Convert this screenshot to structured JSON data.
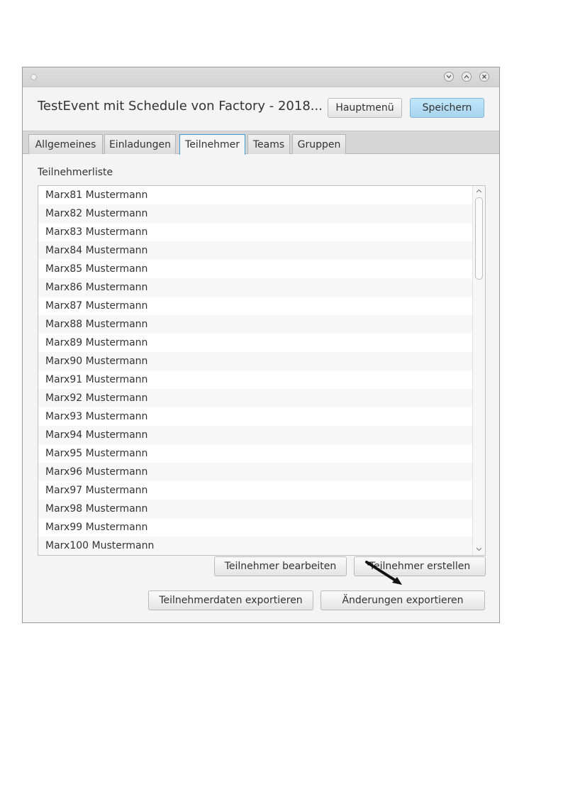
{
  "window": {
    "title": "TestEvent mit Schedule von Factory - 2018...",
    "hauptmenu_label": "Hauptmenü",
    "save_label": "Speichern"
  },
  "tabs": [
    {
      "label": "Allgemeines",
      "active": false
    },
    {
      "label": "Einladungen",
      "active": false
    },
    {
      "label": "Teilnehmer",
      "active": true
    },
    {
      "label": "Teams",
      "active": false
    },
    {
      "label": "Gruppen",
      "active": false
    }
  ],
  "participants": {
    "section_label": "Teilnehmerliste",
    "items": [
      "Marx81 Mustermann",
      "Marx82 Mustermann",
      "Marx83 Mustermann",
      "Marx84 Mustermann",
      "Marx85 Mustermann",
      "Marx86 Mustermann",
      "Marx87 Mustermann",
      "Marx88 Mustermann",
      "Marx89 Mustermann",
      "Marx90 Mustermann",
      "Marx91 Mustermann",
      "Marx92 Mustermann",
      "Marx93 Mustermann",
      "Marx94 Mustermann",
      "Marx95 Mustermann",
      "Marx96 Mustermann",
      "Marx97 Mustermann",
      "Marx98 Mustermann",
      "Marx99 Mustermann",
      "Marx100 Mustermann"
    ]
  },
  "actions": {
    "edit_label": "Teilnehmer bearbeiten",
    "create_label": "Teilnehmer erstellen",
    "export_data_label": "Teilnehmerdaten exportieren",
    "export_changes_label": "Änderungen exportieren"
  },
  "colors": {
    "accent": "#3b9bd9",
    "primary_button": "#a7d4ee"
  },
  "icons": {
    "minimize": "chevron-down-icon",
    "maximize": "chevron-up-icon",
    "close": "close-icon",
    "cursor": "mouse-cursor-icon"
  }
}
